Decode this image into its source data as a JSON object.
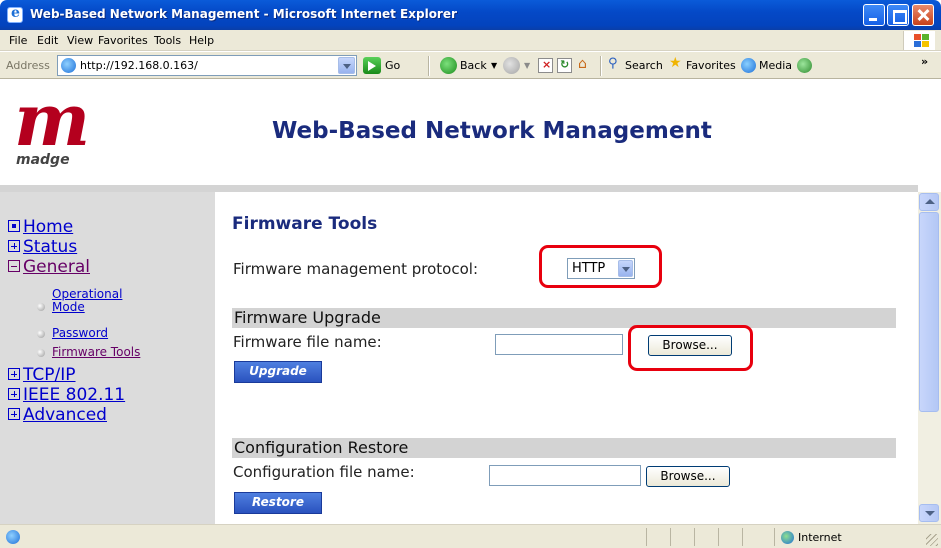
{
  "window": {
    "title": "Web-Based Network Management - Microsoft Internet Explorer"
  },
  "menu": [
    "File",
    "Edit",
    "View",
    "Favorites",
    "Tools",
    "Help"
  ],
  "address": {
    "label": "Address",
    "url": "http://192.168.0.163/",
    "go_label": "Go"
  },
  "toolbar": {
    "back": "Back",
    "search": "Search",
    "favorites": "Favorites",
    "media": "Media"
  },
  "header": {
    "logo_mark": "m",
    "logo_word": "madge",
    "title": "Web-Based Network Management"
  },
  "nav": {
    "home": "Home",
    "status": "Status",
    "general": "General",
    "operational_mode": "Operational Mode",
    "password": "Password",
    "firmware_tools": "Firmware Tools",
    "tcpip": "TCP/IP",
    "ieee": "IEEE 802.11",
    "advanced": "Advanced"
  },
  "content": {
    "title": "Firmware Tools",
    "protocol_label": "Firmware management protocol:",
    "protocol_value": "HTTP",
    "upgrade_section": "Firmware Upgrade",
    "firmware_file_label": "Firmware file name:",
    "browse_label": "Browse...",
    "upgrade_button": "Upgrade",
    "restore_section": "Configuration Restore",
    "config_file_label": "Configuration file name:",
    "restore_button": "Restore"
  },
  "status": {
    "zone": "Internet"
  },
  "colors": {
    "highlight": "#e8000e",
    "title_blue": "#1a2b7d",
    "logo_red": "#b4001e"
  }
}
